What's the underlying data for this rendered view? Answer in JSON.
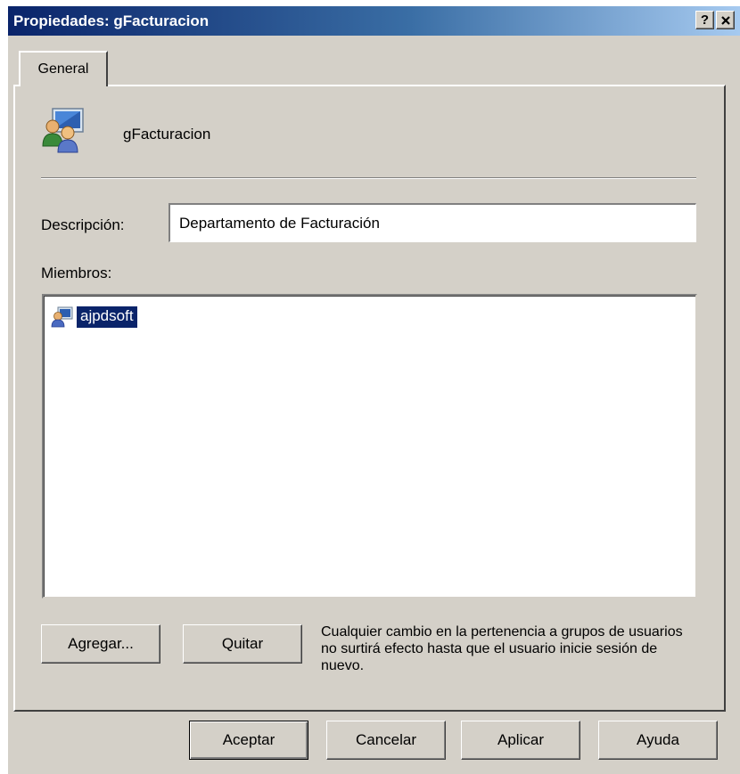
{
  "window": {
    "title": "Propiedades: gFacturacion",
    "help_button": "?",
    "close_button": "✕"
  },
  "tabs": [
    {
      "label": "General"
    }
  ],
  "group": {
    "name": "gFacturacion",
    "icon": "group-users-icon"
  },
  "description": {
    "label": "Descripción:",
    "value": "Departamento de Facturación"
  },
  "members": {
    "label": "Miembros:",
    "items": [
      {
        "name": "ajpdsoft",
        "icon": "user-icon",
        "selected": true
      }
    ]
  },
  "buttons": {
    "add": "Agregar...",
    "remove": "Quitar",
    "ok": "Aceptar",
    "cancel": "Cancelar",
    "apply": "Aplicar",
    "help": "Ayuda"
  },
  "note": "Cualquier cambio en la pertenencia a grupos de usuarios no surtirá efecto hasta que el usuario inicie sesión de nuevo.",
  "colors": {
    "titlebar_start": "#0a246a",
    "titlebar_end": "#a6caf0",
    "dialog_face": "#d4d0c8",
    "selection": "#0a246a"
  }
}
